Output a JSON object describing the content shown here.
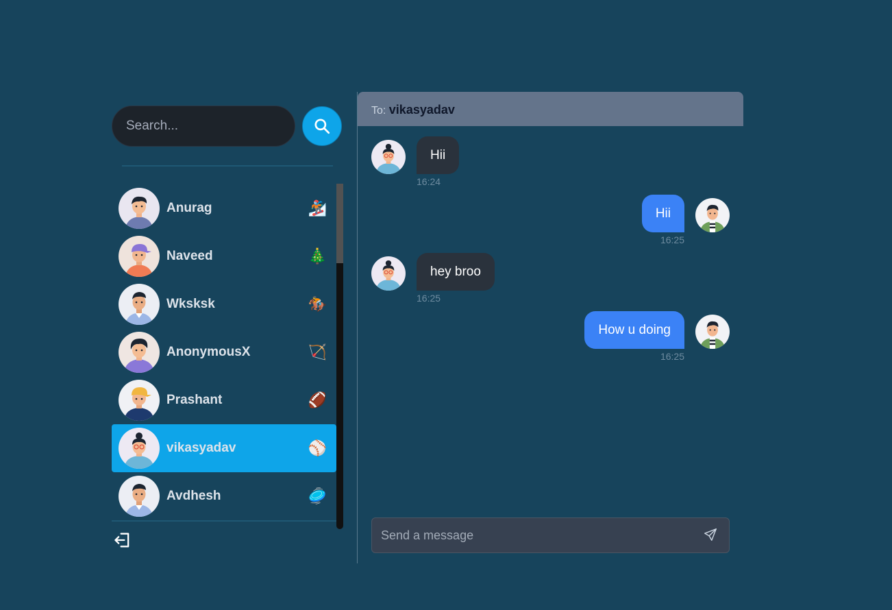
{
  "search": {
    "placeholder": "Search..."
  },
  "contacts": [
    {
      "name": "Anurag",
      "emoji": "🏂",
      "selected": false
    },
    {
      "name": "Naveed",
      "emoji": "🎄",
      "selected": false
    },
    {
      "name": "Wksksk",
      "emoji": "🏇",
      "selected": false
    },
    {
      "name": "AnonymousX",
      "emoji": "🏹",
      "selected": false
    },
    {
      "name": "Prashant",
      "emoji": "🏈",
      "selected": false
    },
    {
      "name": "vikasyadav",
      "emoji": "⚾",
      "selected": true
    },
    {
      "name": "Avdhesh",
      "emoji": "🥏",
      "selected": false
    }
  ],
  "chat": {
    "to_label": "To:",
    "to_name": "vikasyadav",
    "messages": [
      {
        "text": "Hii",
        "time": "16:24",
        "direction": "in"
      },
      {
        "text": "Hii",
        "time": "16:25",
        "direction": "out"
      },
      {
        "text": "hey broo",
        "time": "16:25",
        "direction": "in"
      },
      {
        "text": "How u doing",
        "time": "16:25",
        "direction": "out"
      }
    ]
  },
  "composer": {
    "placeholder": "Send a message"
  },
  "icons": {
    "search": "search-icon",
    "send": "send-icon",
    "logout": "logout-icon"
  },
  "colors": {
    "background": "#17445c",
    "accent": "#0ea5e9",
    "outgoing_bubble": "#3b82f6",
    "incoming_bubble": "#2a323c",
    "header": "#64748b"
  }
}
